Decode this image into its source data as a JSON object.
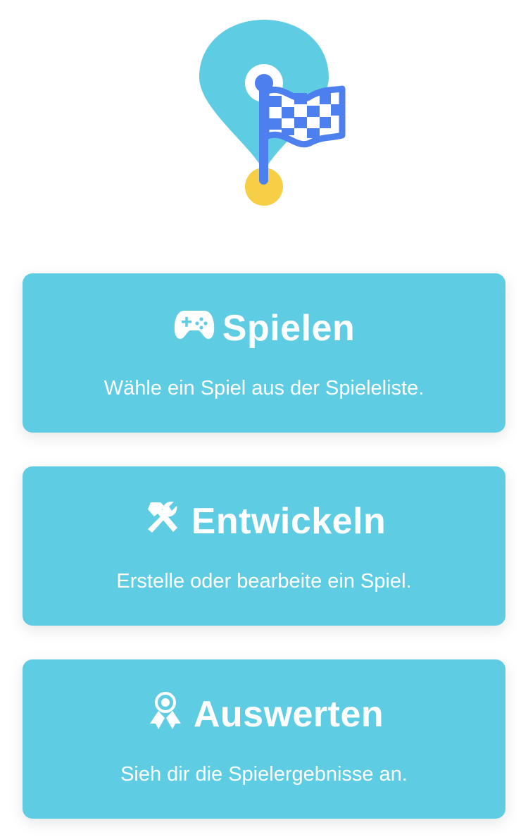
{
  "app": {
    "logo_icon": "map-pin-racing-flag-icon",
    "colors": {
      "card_background": "#5ecde3",
      "card_text": "#ffffff",
      "pin_color": "#5ecde3",
      "flag_color": "#4d7fee",
      "pin_base_color": "#f7cf46"
    }
  },
  "menu": {
    "items": [
      {
        "icon": "gamepad-icon",
        "title": "Spielen",
        "description": "Wähle ein Spiel aus der Spieleliste."
      },
      {
        "icon": "tools-icon",
        "title": "Entwickeln",
        "description": "Erstelle oder bearbeite ein Spiel."
      },
      {
        "icon": "award-ribbon-icon",
        "title": "Auswerten",
        "description": "Sieh dir die Spielergebnisse an."
      }
    ]
  }
}
